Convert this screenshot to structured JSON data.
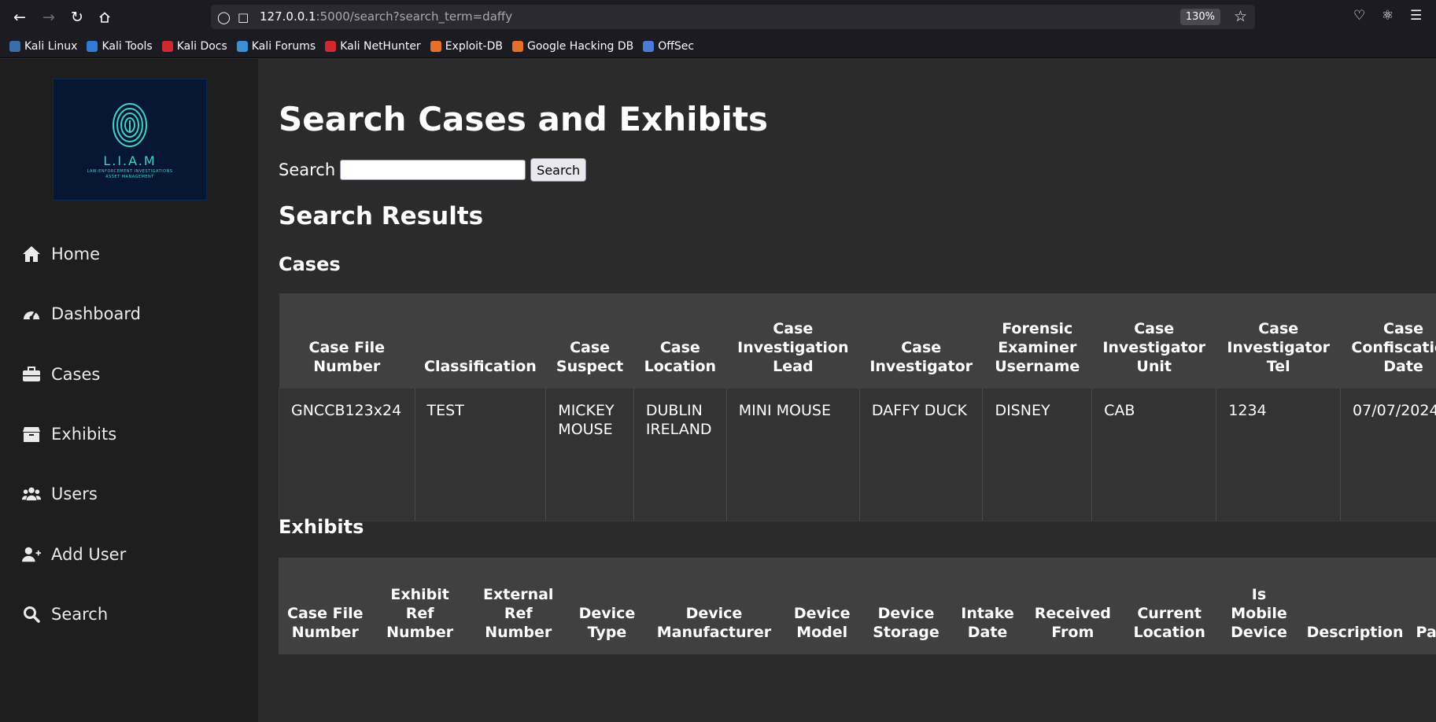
{
  "browser": {
    "url_host": "127.0.0.1",
    "url_rest": ":5000/search?search_term=daffy",
    "zoom": "130%",
    "bookmarks": [
      {
        "label": "Kali Linux",
        "color": "#3a6ea8"
      },
      {
        "label": "Kali Tools",
        "color": "#2f7bd6"
      },
      {
        "label": "Kali Docs",
        "color": "#d0282f"
      },
      {
        "label": "Kali Forums",
        "color": "#3a8fd6"
      },
      {
        "label": "Kali NetHunter",
        "color": "#d0282f"
      },
      {
        "label": "Exploit-DB",
        "color": "#e5702a"
      },
      {
        "label": "Google Hacking DB",
        "color": "#e5702a"
      },
      {
        "label": "OffSec",
        "color": "#4a7bd6"
      }
    ]
  },
  "logo": {
    "title": "L.I.A.M",
    "subtitle_line1": "LAW-ENFORCEMENT INVESTIGATIONS",
    "subtitle_line2": "ASSET MANAGEMENT"
  },
  "sidebar": {
    "items": [
      {
        "label": "Home",
        "icon": "home-icon"
      },
      {
        "label": "Dashboard",
        "icon": "dashboard-icon"
      },
      {
        "label": "Cases",
        "icon": "briefcase-icon"
      },
      {
        "label": "Exhibits",
        "icon": "box-icon"
      },
      {
        "label": "Users",
        "icon": "users-icon"
      },
      {
        "label": "Add User",
        "icon": "user-plus-icon"
      },
      {
        "label": "Search",
        "icon": "search-icon"
      }
    ]
  },
  "main": {
    "title": "Search Cases and Exhibits",
    "search_label": "Search",
    "search_value": "",
    "search_button": "Search",
    "results_heading": "Search Results",
    "cases_heading": "Cases",
    "exhibits_heading": "Exhibits"
  },
  "cases_table": {
    "headers": [
      "Case File Number",
      "Classification",
      "Case Suspect",
      "Case Location",
      "Case Investigation Lead",
      "Case Investigator",
      "Forensic Examiner Username",
      "Case Investigator Unit",
      "Case Investigator Tel",
      "Case Confiscation Date"
    ],
    "rows": [
      [
        "GNCCB123x24",
        "TEST",
        "MICKEY MOUSE",
        "DUBLIN IRELAND",
        "MINI MOUSE",
        "DAFFY DUCK",
        "DISNEY",
        "CAB",
        "1234",
        "07/07/2024"
      ]
    ]
  },
  "exhibits_table": {
    "headers": [
      "Case File Number",
      "Exhibit Ref Number",
      "External Ref Number",
      "Device Type",
      "Device Manufacturer",
      "Device Model",
      "Device Storage",
      "Intake Date",
      "Received From",
      "Current Location",
      "Is Mobile Device",
      "Description",
      "Passw"
    ]
  }
}
